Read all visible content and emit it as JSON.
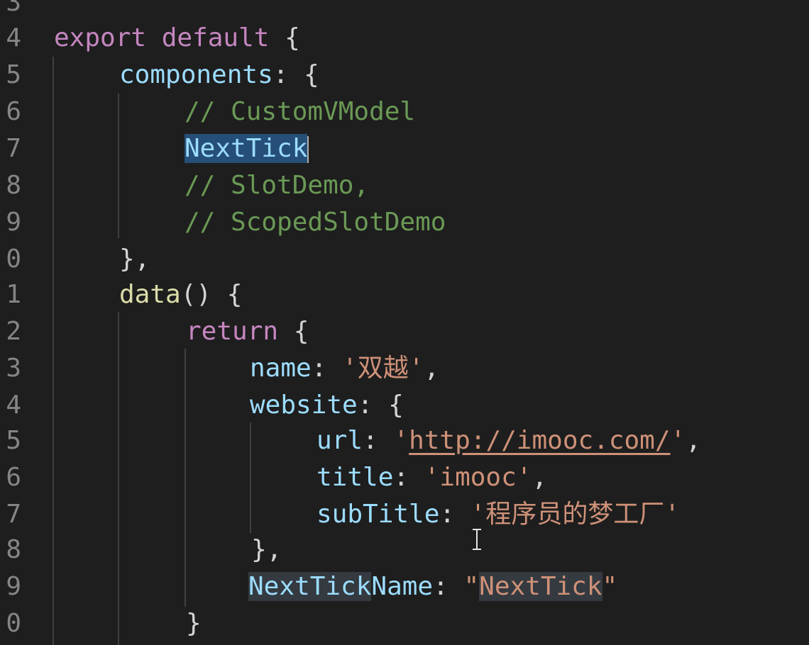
{
  "editor": {
    "lines": [
      {
        "num": "3",
        "tokens": []
      },
      {
        "num": "4",
        "tokens": [
          {
            "t": "export default",
            "c": "kw"
          },
          {
            "t": " {",
            "c": "punc"
          }
        ]
      },
      {
        "num": "5",
        "tokens": [
          {
            "t": "components",
            "c": "prop"
          },
          {
            "t": ": {",
            "c": "punc"
          }
        ]
      },
      {
        "num": "6",
        "tokens": [
          {
            "t": "// CustomVModel",
            "c": "cmt"
          }
        ]
      },
      {
        "num": "7",
        "tokens": [
          {
            "t": "NextTick",
            "c": "prop sel"
          },
          {
            "caret": true
          }
        ]
      },
      {
        "num": "8",
        "tokens": [
          {
            "t": "// SlotDemo,",
            "c": "cmt"
          }
        ]
      },
      {
        "num": "9",
        "tokens": [
          {
            "t": "// ScopedSlotDemo",
            "c": "cmt"
          }
        ]
      },
      {
        "num": "0",
        "tokens": [
          {
            "t": "},",
            "c": "punc"
          }
        ]
      },
      {
        "num": "1",
        "tokens": [
          {
            "t": "data",
            "c": "fn"
          },
          {
            "t": "() {",
            "c": "punc"
          }
        ]
      },
      {
        "num": "2",
        "tokens": [
          {
            "t": "return",
            "c": "kw"
          },
          {
            "t": " {",
            "c": "punc"
          }
        ]
      },
      {
        "num": "3",
        "tokens": [
          {
            "t": "name",
            "c": "prop"
          },
          {
            "t": ": ",
            "c": "punc"
          },
          {
            "t": "'双越'",
            "c": "str"
          },
          {
            "t": ",",
            "c": "punc"
          }
        ]
      },
      {
        "num": "4",
        "tokens": [
          {
            "t": "website",
            "c": "prop"
          },
          {
            "t": ": {",
            "c": "punc"
          }
        ]
      },
      {
        "num": "5",
        "tokens": [
          {
            "t": "url",
            "c": "prop"
          },
          {
            "t": ": ",
            "c": "punc"
          },
          {
            "t": "'",
            "c": "str"
          },
          {
            "t": "http://imooc.com/",
            "c": "str url"
          },
          {
            "t": "'",
            "c": "str"
          },
          {
            "t": ",",
            "c": "punc"
          }
        ]
      },
      {
        "num": "6",
        "tokens": [
          {
            "t": "title",
            "c": "prop"
          },
          {
            "t": ": ",
            "c": "punc"
          },
          {
            "t": "'imooc'",
            "c": "str"
          },
          {
            "t": ",",
            "c": "punc"
          }
        ]
      },
      {
        "num": "7",
        "tokens": [
          {
            "t": "subTitle",
            "c": "prop"
          },
          {
            "t": ": ",
            "c": "punc"
          },
          {
            "t": "'程序员的梦工厂'",
            "c": "str"
          }
        ]
      },
      {
        "num": "8",
        "tokens": [
          {
            "t": "},",
            "c": "punc"
          }
        ]
      },
      {
        "num": "9",
        "tokens": [
          {
            "t": "NextTick",
            "c": "prop hl"
          },
          {
            "t": "Name",
            "c": "prop"
          },
          {
            "t": ": ",
            "c": "punc"
          },
          {
            "t": "\"",
            "c": "str"
          },
          {
            "t": "NextTick",
            "c": "str hl"
          },
          {
            "t": "\"",
            "c": "str"
          }
        ]
      },
      {
        "num": "0",
        "tokens": [
          {
            "t": "}",
            "c": "punc"
          }
        ]
      }
    ]
  }
}
